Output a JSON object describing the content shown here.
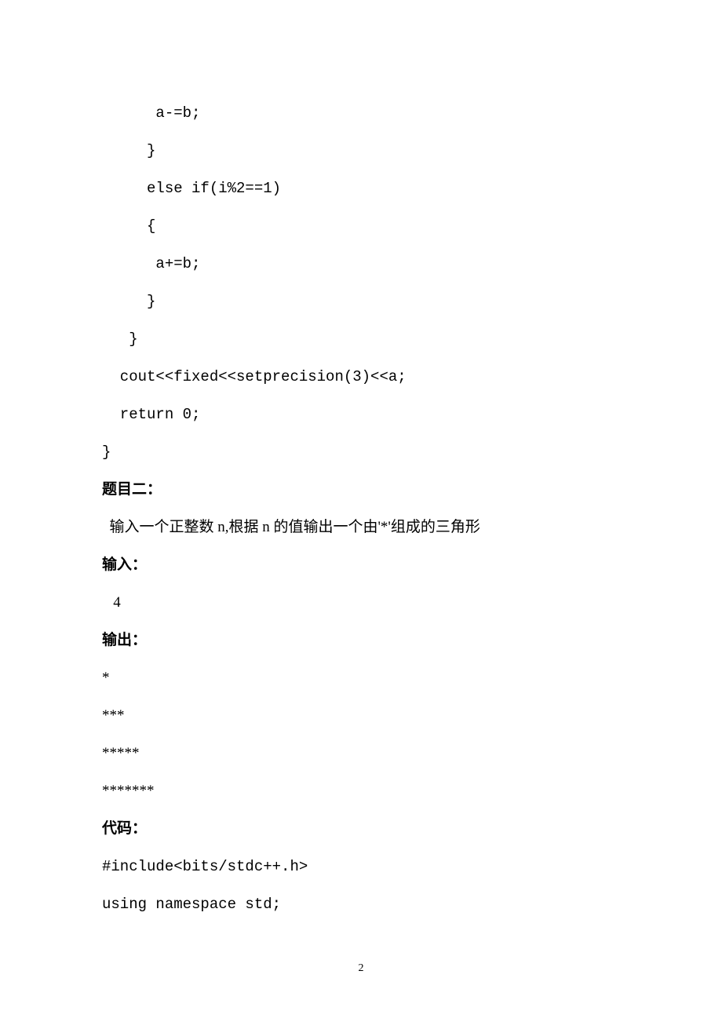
{
  "code1": {
    "l1": "      a-=b;",
    "l2": "     }",
    "l3": "     else if(i%2==1)",
    "l4": "     {",
    "l5": "      a+=b;",
    "l6": "     }",
    "l7": "   }",
    "l8": "  cout<<fixed<<setprecision(3)<<a;",
    "l9": "  return 0;",
    "l10": "}"
  },
  "problem2": {
    "title": "题目二：",
    "desc": "  输入一个正整数 n,根据 n 的值输出一个由'*'组成的三角形",
    "input_label": "输入：",
    "input_value": "   4",
    "output_label": "输出：",
    "out1": "*",
    "out2": "***",
    "out3": "*****",
    "out4": "*******",
    "code_label": "代码：",
    "code_l1": "#include<bits/stdc++.h>",
    "code_l2": "using namespace std;"
  },
  "page_number": "2"
}
